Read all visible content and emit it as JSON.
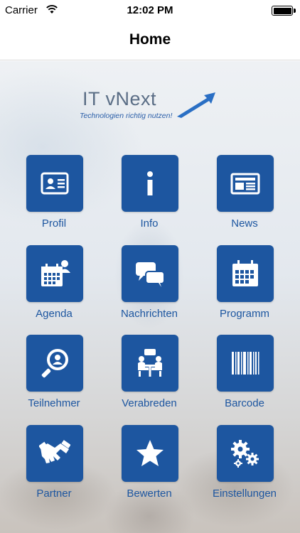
{
  "status_bar": {
    "carrier": "Carrier",
    "time": "12:02 PM"
  },
  "nav": {
    "title": "Home"
  },
  "logo": {
    "brand": "IT vNext",
    "tagline": "Technologien richtig nutzen!"
  },
  "colors": {
    "tile": "#1d56a0",
    "label": "#1d56a0"
  },
  "tiles": [
    {
      "label": "Profil",
      "icon": "profile-card-icon"
    },
    {
      "label": "Info",
      "icon": "info-icon"
    },
    {
      "label": "News",
      "icon": "newspaper-icon"
    },
    {
      "label": "Agenda",
      "icon": "calendar-person-icon"
    },
    {
      "label": "Nachrichten",
      "icon": "chat-bubbles-icon"
    },
    {
      "label": "Programm",
      "icon": "calendar-icon"
    },
    {
      "label": "Teilnehmer",
      "icon": "search-person-icon"
    },
    {
      "label": "Verabreden",
      "icon": "meeting-icon"
    },
    {
      "label": "Barcode",
      "icon": "barcode-icon"
    },
    {
      "label": "Partner",
      "icon": "handshake-icon"
    },
    {
      "label": "Bewerten",
      "icon": "star-icon"
    },
    {
      "label": "Einstellungen",
      "icon": "gears-icon"
    }
  ]
}
